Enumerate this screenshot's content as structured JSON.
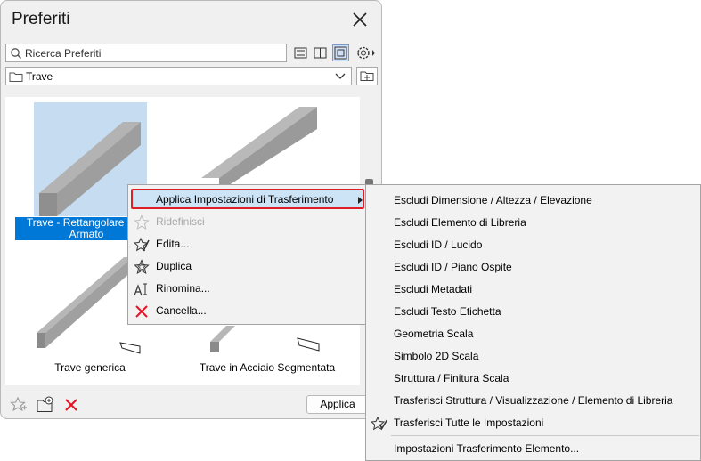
{
  "palette": {
    "title": "Preferiti",
    "search_placeholder": "Ricerca Preferiti",
    "folder": "Trave",
    "apply_label": "Applica",
    "items": [
      {
        "label_line1": "Trave - Rettangolare in C",
        "label_line2": "Armato"
      },
      {
        "label_line1": "",
        "label_line2": ""
      },
      {
        "label_line1": "Trave generica",
        "label_line2": ""
      },
      {
        "label_line1": "Trave in Acciaio Segmentata",
        "label_line2": ""
      }
    ]
  },
  "context_menu": {
    "items": [
      {
        "label": "Applica Impostazioni di Trasferimento",
        "icon": "none",
        "enabled": true,
        "has_submenu": true,
        "highlighted": true
      },
      {
        "label": "Ridefinisci",
        "icon": "star-outline-icon",
        "enabled": false
      },
      {
        "label": "Edita...",
        "icon": "edit-star-icon",
        "enabled": true
      },
      {
        "label": "Duplica",
        "icon": "duplicate-star-icon",
        "enabled": true
      },
      {
        "label": "Rinomina...",
        "icon": "rename-icon",
        "enabled": true
      },
      {
        "label": "Cancella...",
        "icon": "red-x-icon",
        "enabled": true
      }
    ]
  },
  "submenu": {
    "items": [
      {
        "label": "Escludi Dimensione / Altezza / Elevazione"
      },
      {
        "label": "Escludi Elemento di Libreria"
      },
      {
        "label": "Escludi ID / Lucido"
      },
      {
        "label": "Escludi ID / Piano Ospite"
      },
      {
        "label": "Escludi Metadati"
      },
      {
        "label": "Escludi Testo Etichetta"
      },
      {
        "label": "Geometria Scala"
      },
      {
        "label": "Simbolo 2D Scala"
      },
      {
        "label": "Struttura / Finitura Scala"
      },
      {
        "label": "Trasferisci Struttura / Visualizzazione / Elemento di Libreria"
      },
      {
        "label": "Trasferisci Tutte le Impostazioni",
        "icon": "star-check-icon"
      },
      {
        "label": "Impostazioni Trasferimento Elemento..."
      }
    ]
  },
  "colors": {
    "accent": "#0078d7",
    "highlight_border": "#e01e25",
    "delete": "#e81123"
  }
}
